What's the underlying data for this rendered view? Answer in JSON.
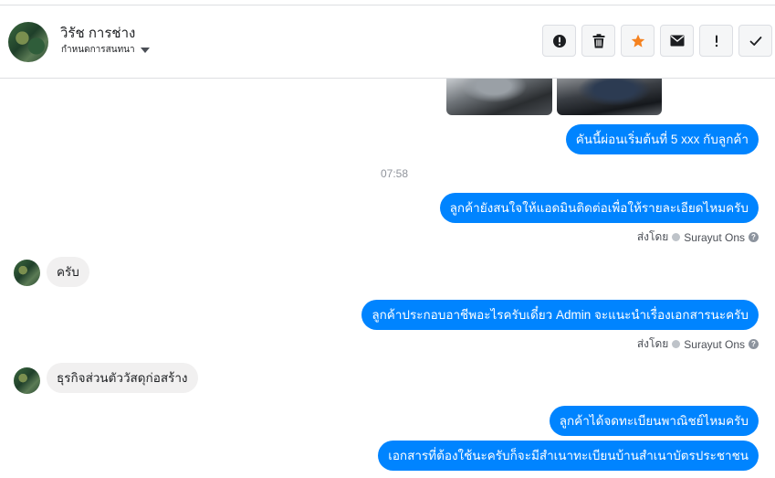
{
  "header": {
    "contact_name": "วิรัช การช่าง",
    "subtitle": "กำหนดการสนทนา",
    "toolbar": {
      "spam_icon": "exclamation-circle-icon",
      "delete_icon": "trash-icon",
      "star_icon": "star-icon",
      "mail_icon": "envelope-icon",
      "important_icon": "exclamation-icon",
      "done_icon": "check-icon",
      "star_color": "#f5821f"
    }
  },
  "messages": {
    "m1": "คันนี้ผ่อนเริ่มต้นที่ 5 xxx กับลูกค้า",
    "time_divider": "07:58",
    "m2": "ลูกค้ายังสนใจให้แอดมินติดต่อเพื่อให้รายละเอียดไหมครับ",
    "seen1": {
      "prefix": "ส่งโดย",
      "name": "Surayut Ons",
      "help": "?"
    },
    "m3": "ครับ",
    "m4": "ลูกค้าประกอบอาชีพอะไรครับเดี๋ยว Admin จะแนะนำเรื่องเอกสารนะครับ",
    "seen2": {
      "prefix": "ส่งโดย",
      "name": "Surayut Ons",
      "help": "?"
    },
    "m5": "ธุรกิจส่วนตัววัสดุก่อสร้าง",
    "m6": "ลูกค้าได้จดทะเบียนพาณิชย์ไหมครับ",
    "m7": "เอกสารที่ต้องใช้นะครับก็จะมีสำเนาทะเบียนบ้านสำเนาบัตรประชาชน"
  },
  "colors": {
    "outgoing_bubble": "#0084ff",
    "incoming_bubble": "#f1f0f0"
  }
}
